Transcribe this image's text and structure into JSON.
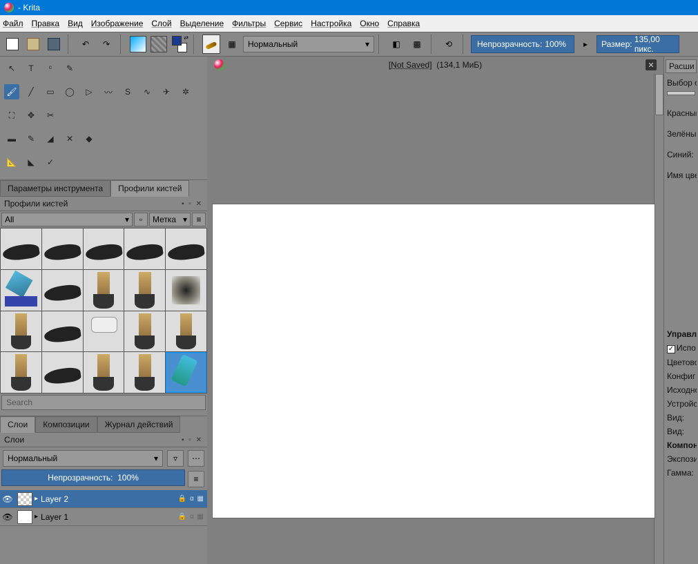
{
  "title": "- Krita",
  "menu": [
    "Файл",
    "Правка",
    "Вид",
    "Изображение",
    "Слой",
    "Выделение",
    "Фильтры",
    "Сервис",
    "Настройка",
    "Окно",
    "Справка"
  ],
  "toolbar": {
    "blend_mode": "Нормальный",
    "opacity_label": "Непрозрачность:",
    "opacity_value": "100%",
    "size_label": "Размер:",
    "size_value": "135,00 пикс."
  },
  "document": {
    "title_prefix": "[",
    "title_text": "Not Saved",
    "title_suffix": "]",
    "info": "(134,1 МиБ)"
  },
  "left_tabs": {
    "tool_options": "Параметры инструмента",
    "brush_presets": "Профили кистей"
  },
  "brush_dock": {
    "title": "Профили кистей",
    "filter_all": "All",
    "tag_label": "Метка",
    "search_placeholder": "Search"
  },
  "layer_tabs": {
    "layers": "Слои",
    "compositions": "Композиции",
    "log": "Журнал действий"
  },
  "layers": {
    "title": "Слои",
    "blend_mode": "Нормальный",
    "opacity_label": "Непрозрачность:",
    "opacity_value": "100%",
    "items": [
      {
        "name": "Layer 2",
        "selected": true
      },
      {
        "name": "Layer 1",
        "selected": false
      }
    ]
  },
  "right": {
    "hdr1": "Расши",
    "sel_label": "Выбор о",
    "red": "Красный",
    "green": "Зелёный",
    "blue": "Синий:",
    "name": "Имя цве",
    "hdr2": "Управле",
    "use": "Испо",
    "colorspace": "Цветово",
    "config": "Конфиг",
    "source": "Исходно",
    "device": "Устройс",
    "view1": "Вид:",
    "view2": "Вид:",
    "component": "Компон",
    "exposure": "Экспози",
    "gamma": "Гамма:"
  }
}
